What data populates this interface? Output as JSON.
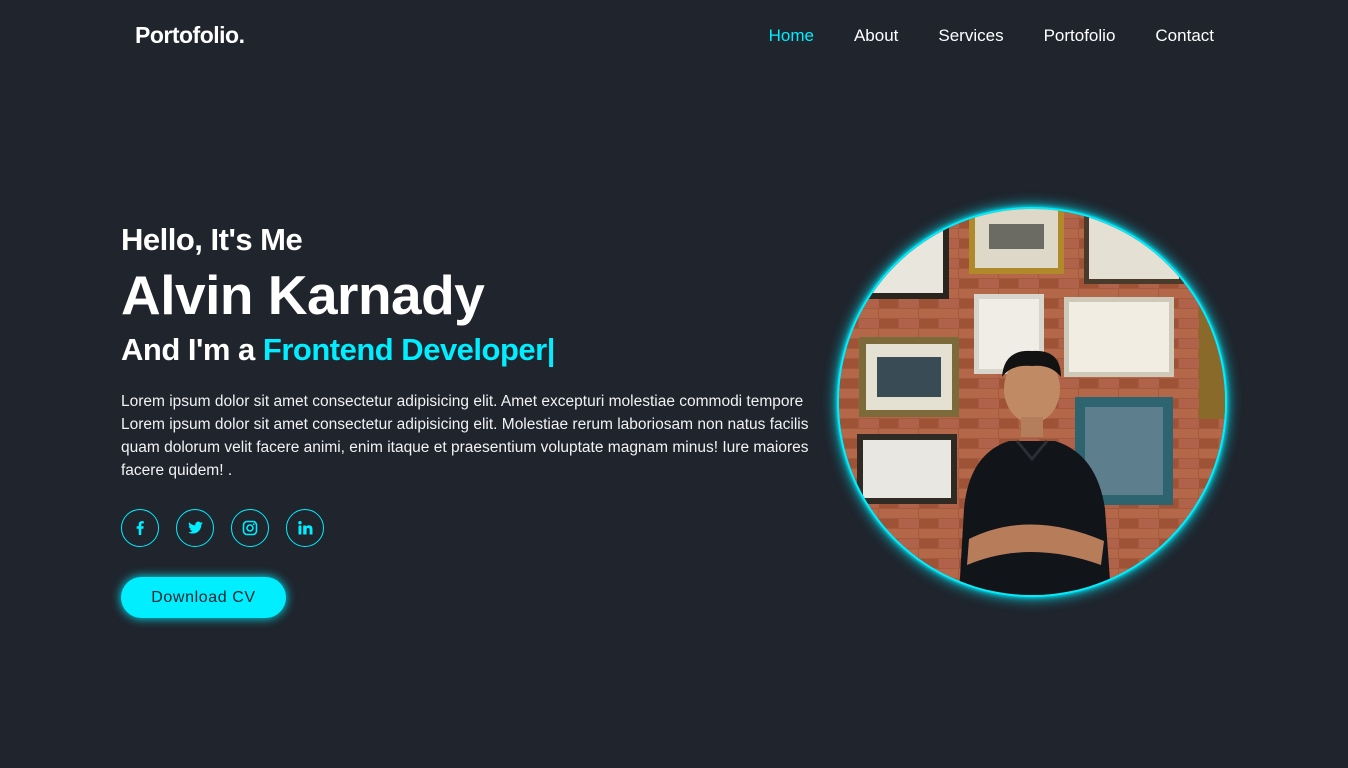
{
  "header": {
    "logo": "Portofolio.",
    "nav": [
      {
        "label": "Home",
        "active": true
      },
      {
        "label": "About",
        "active": false
      },
      {
        "label": "Services",
        "active": false
      },
      {
        "label": "Portofolio",
        "active": false
      },
      {
        "label": "Contact",
        "active": false
      }
    ]
  },
  "home": {
    "greeting": "Hello, It's Me",
    "name": "Alvin Karnady",
    "role_prefix": "And I'm a ",
    "role_highlight": "Frontend Developer|",
    "description": "Lorem ipsum dolor sit amet consectetur adipisicing elit. Amet excepturi molestiae commodi tempore Lorem ipsum dolor sit amet consectetur adipisicing elit. Molestiae rerum laboriosam non natus facilis quam dolorum velit facere animi, enim itaque et praesentium voluptate magnam minus! Iure maiores facere quidem! .",
    "social": [
      {
        "icon": "facebook-icon"
      },
      {
        "icon": "twitter-icon"
      },
      {
        "icon": "instagram-icon"
      },
      {
        "icon": "linkedin-icon"
      }
    ],
    "cta_label": "Download CV"
  },
  "colors": {
    "background": "#1f242d",
    "accent": "#00eeff",
    "text": "#ffffff"
  }
}
